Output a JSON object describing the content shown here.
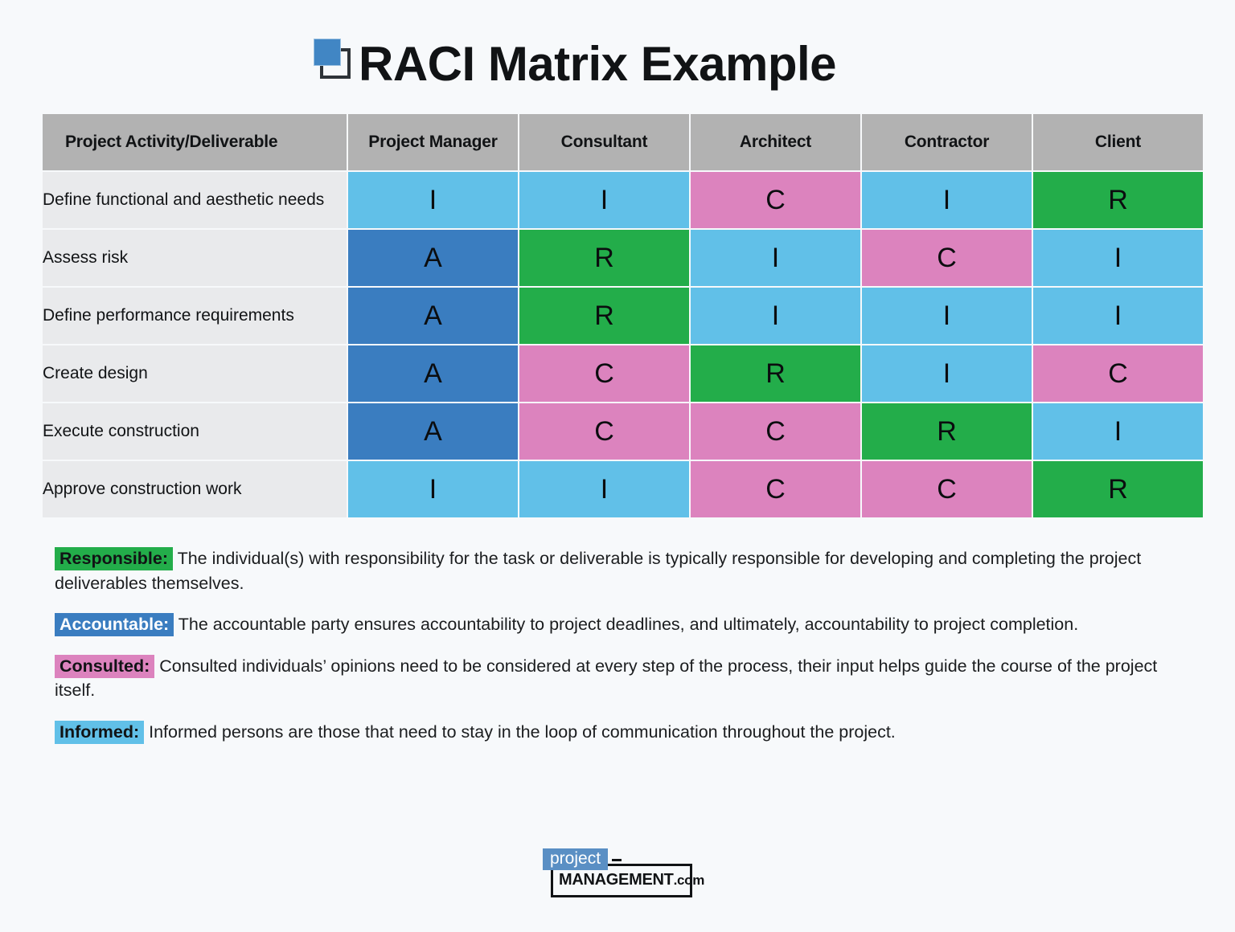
{
  "header": {
    "title": "RACI Matrix Example",
    "logo_icon": "overlapping-squares-icon"
  },
  "chart_data": {
    "type": "table",
    "title": "RACI Matrix Example",
    "columns": [
      "Project Activity/Deliverable",
      "Project Manager",
      "Consultant",
      "Architect",
      "Contractor",
      "Client"
    ],
    "rows": [
      {
        "activity": "Define functional and aesthetic needs",
        "values": [
          "I",
          "I",
          "C",
          "I",
          "R"
        ]
      },
      {
        "activity": "Assess risk",
        "values": [
          "A",
          "R",
          "I",
          "C",
          "I"
        ]
      },
      {
        "activity": "Define performance requirements",
        "values": [
          "A",
          "R",
          "I",
          "I",
          "I"
        ]
      },
      {
        "activity": "Create design",
        "values": [
          "A",
          "C",
          "R",
          "I",
          "C"
        ]
      },
      {
        "activity": "Execute construction",
        "values": [
          "A",
          "C",
          "C",
          "R",
          "I"
        ]
      },
      {
        "activity": "Approve construction work",
        "values": [
          "I",
          "I",
          "C",
          "C",
          "R"
        ]
      }
    ],
    "code_colors": {
      "R": "#23ad4a",
      "A": "#3a7dc0",
      "C": "#dc83be",
      "I": "#61c0e8"
    },
    "header_color": "#b2b2b2",
    "activity_cell_color": "#e9eaec"
  },
  "legend": [
    {
      "tag": "Responsible:",
      "text": " The individual(s) with responsibility for the task or deliverable is typically responsible for developing and completing the project deliverables themselves.",
      "color": "#23ad4a"
    },
    {
      "tag": "Accountable:",
      "text": " The accountable party ensures accountability to project deadlines, and ultimately, accountability to project completion.",
      "color": "#3a7dc0"
    },
    {
      "tag": "Consulted:",
      "text": " Consulted individuals’ opinions need to be considered at every step of the process, their input helps guide the course of the project itself.",
      "color": "#dc83be"
    },
    {
      "tag": "Informed:",
      "text": " Informed persons are those that need to stay in the loop of communication throughout the project.",
      "color": "#61c0e8"
    }
  ],
  "footer": {
    "logo_project": "project",
    "logo_management": "MANAGEMENT",
    "logo_dotcom": ".com"
  }
}
